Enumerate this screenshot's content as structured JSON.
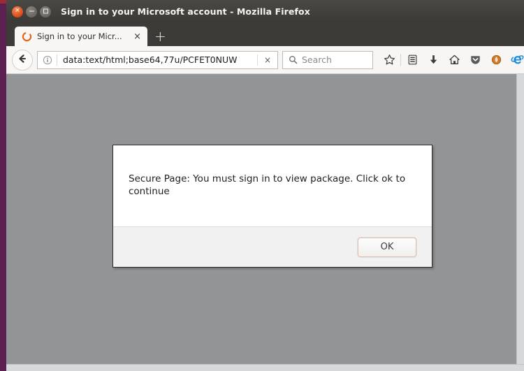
{
  "window": {
    "title": "Sign in to your Microsoft account - Mozilla Firefox",
    "controls": {
      "close_label": "×",
      "minimize_label": "",
      "maximize_label": ""
    },
    "frame_color": "#5c2050",
    "titlebar_color": "#3c3b37",
    "top_stripe_color": "#9c2a35"
  },
  "tabs": {
    "items": [
      {
        "label": "Sign in to your Micr...",
        "favicon": "firefox-circle-icon",
        "close_label": "×"
      }
    ],
    "new_tab_label": "+"
  },
  "toolbar": {
    "back_icon": "back-arrow-icon",
    "url": {
      "info_icon": "info-circle-icon",
      "value": "data:text/html;base64,77u/PCFET0NUW",
      "clear_label": "×"
    },
    "search": {
      "icon": "search-icon",
      "placeholder": "Search",
      "value": ""
    },
    "icons": [
      {
        "name": "bookmark-star-icon"
      },
      {
        "name": "library-icon"
      },
      {
        "name": "downloads-icon"
      },
      {
        "name": "home-icon"
      },
      {
        "name": "pocket-icon"
      },
      {
        "name": "addon-orange-icon"
      },
      {
        "name": "internet-explorer-icon"
      }
    ]
  },
  "page": {
    "background_color": "#929496"
  },
  "dialog": {
    "message": "Secure Page: You must sign in to view package. Click ok to continue",
    "ok_label": "OK",
    "accent_border_color": "#dcc0b4",
    "footer_color": "#f1f1f1"
  }
}
